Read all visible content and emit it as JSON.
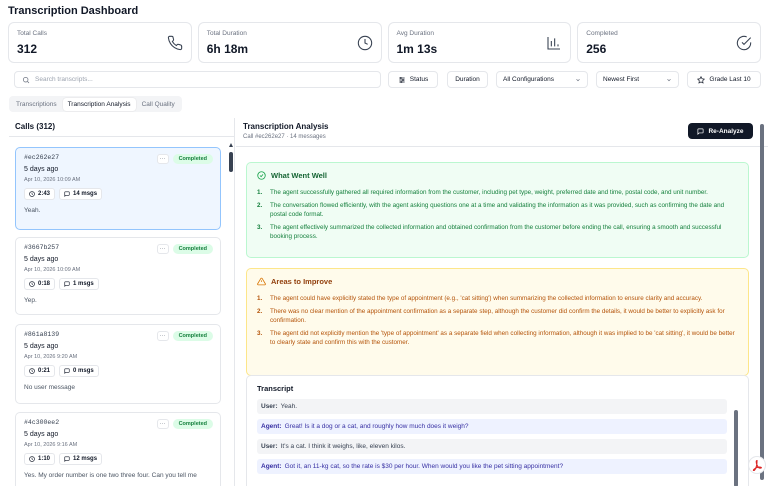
{
  "page": {
    "title": "Transcription Dashboard"
  },
  "stats": [
    {
      "label": "Total Calls",
      "value": "312",
      "icon": "phone-icon"
    },
    {
      "label": "Total Duration",
      "value": "6h 18m",
      "icon": "clock-icon"
    },
    {
      "label": "Avg Duration",
      "value": "1m 13s",
      "icon": "bar-chart-icon"
    },
    {
      "label": "Completed",
      "value": "256",
      "icon": "check-circle-icon"
    }
  ],
  "filters": {
    "search_placeholder": "Search transcripts...",
    "status_label": "Status",
    "duration_label": "Duration",
    "config_value": "All Configurations",
    "sort_value": "Newest First",
    "grade_label": "Grade Last 10"
  },
  "tabs": [
    "Transcriptions",
    "Transcription Analysis",
    "Call Quality"
  ],
  "calls": {
    "header": "Calls (312)",
    "items": [
      {
        "id": "#ec262e27",
        "ago": "5 days ago",
        "date": "Apr 10, 2026 10:09 AM",
        "duration": "2:43",
        "msgs": "14 msgs",
        "message": "Yeah.",
        "status": "Completed"
      },
      {
        "id": "#3667b257",
        "ago": "5 days ago",
        "date": "Apr 10, 2026 10:09 AM",
        "duration": "0:18",
        "msgs": "1 msgs",
        "message": "Yep.",
        "status": "Completed"
      },
      {
        "id": "#861a8139",
        "ago": "5 days ago",
        "date": "Apr 10, 2026 9:20 AM",
        "duration": "0:21",
        "msgs": "0 msgs",
        "message": "No user message",
        "status": "Completed"
      },
      {
        "id": "#4c300ee2",
        "ago": "5 days ago",
        "date": "Apr 10, 2026 9:16 AM",
        "duration": "1:10",
        "msgs": "12 msgs",
        "message": "Yes. My order number is one two three four. Can you tell me",
        "status": "Completed"
      }
    ]
  },
  "analysis": {
    "title": "Transcription Analysis",
    "subtitle": "Call #ec262e27 · 14 messages",
    "reanalyze_label": "Re-Analyze",
    "went_well_title": "What Went Well",
    "went_well": [
      "The agent successfully gathered all required information from the customer, including pet type, weight, preferred date and time, postal code, and unit number.",
      "The conversation flowed efficiently, with the agent asking questions one at a time and validating the information as it was provided, such as confirming the date and postal code format.",
      "The agent effectively summarized the collected information and obtained confirmation from the customer before ending the call, ensuring a smooth and successful booking process."
    ],
    "improve_title": "Areas to Improve",
    "improve": [
      "The agent could have explicitly stated the type of appointment (e.g., 'cat sitting') when summarizing the collected information to ensure clarity and accuracy.",
      "There was no clear mention of the appointment confirmation as a separate step, although the customer did confirm the details, it would be better to explicitly ask for confirmation.",
      "The agent did not explicitly mention the 'type of appointment' as a separate field when collecting information, although it was implied to be 'cat sitting', it would be better to clearly state and confirm this with the customer."
    ],
    "transcript_title": "Transcript",
    "transcript": [
      {
        "speaker": "User:",
        "text": "Yeah."
      },
      {
        "speaker": "Agent:",
        "text": "Great! Is it a dog or a cat, and roughly how much does it weigh?"
      },
      {
        "speaker": "User:",
        "text": "It's a cat. I think it weighs, like, eleven kilos."
      },
      {
        "speaker": "Agent:",
        "text": "Got it, an 11-kg cat, so the rate is $30 per hour. When would you like the pet sitting appointment?"
      }
    ]
  },
  "colors": {
    "accent": "#111827",
    "success": "#15803d",
    "warning": "#b45309",
    "selected": "#eff6ff"
  }
}
